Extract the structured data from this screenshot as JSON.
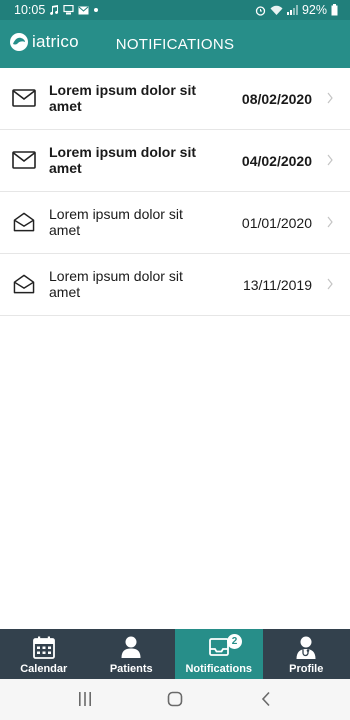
{
  "status_bar": {
    "time": "10:05",
    "battery_percent": "92%"
  },
  "header": {
    "logo_text": "iatrico",
    "title": "NOTIFICATIONS"
  },
  "notifications": [
    {
      "text": "Lorem ipsum dolor sit amet",
      "date": "08/02/2020",
      "read": false
    },
    {
      "text": "Lorem ipsum dolor sit amet",
      "date": "04/02/2020",
      "read": false
    },
    {
      "text": "Lorem ipsum dolor sit amet",
      "date": "01/01/2020",
      "read": true
    },
    {
      "text": "Lorem ipsum dolor sit amet",
      "date": "13/11/2019",
      "read": true
    }
  ],
  "tabs": [
    {
      "label": "Calendar",
      "icon": "calendar-icon"
    },
    {
      "label": "Patients",
      "icon": "person-icon"
    },
    {
      "label": "Notifications",
      "icon": "inbox-icon",
      "badge": "2",
      "active": true
    },
    {
      "label": "Profile",
      "icon": "doctor-icon"
    }
  ],
  "colors": {
    "primary": "#278e89",
    "status_bar": "#217f7b",
    "tab_bar": "#33414d"
  }
}
